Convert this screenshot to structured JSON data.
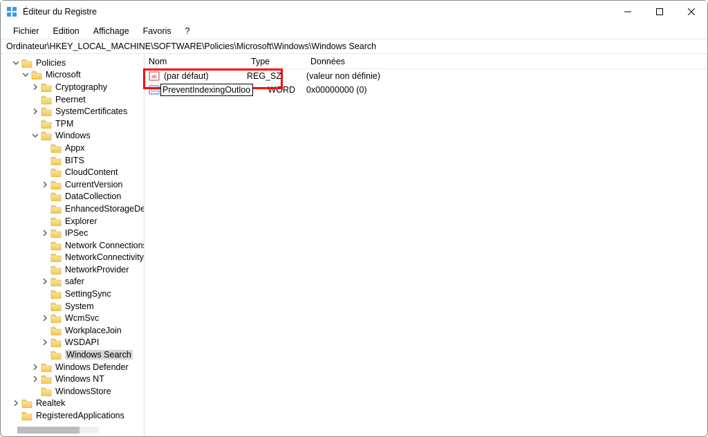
{
  "window": {
    "title": "Éditeur du Registre"
  },
  "menu": {
    "file": "Fichier",
    "edit": "Edition",
    "view": "Affichage",
    "favorites": "Favoris",
    "help": "?"
  },
  "address": {
    "path": "Ordinateur\\HKEY_LOCAL_MACHINE\\SOFTWARE\\Policies\\Microsoft\\Windows\\Windows Search"
  },
  "tree": {
    "policies": "Policies",
    "microsoft": "Microsoft",
    "items": {
      "cryptography": "Cryptography",
      "peernet": "Peernet",
      "systemcertificates": "SystemCertificates",
      "tpm": "TPM",
      "windows": "Windows"
    },
    "winitems": {
      "appx": "Appx",
      "bits": "BITS",
      "cloudcontent": "CloudContent",
      "currentversion": "CurrentVersion",
      "datacollection": "DataCollection",
      "enhancedstorage": "EnhancedStorageDevices",
      "explorer": "Explorer",
      "ipsec": "IPSec",
      "networkconnections": "Network Connections",
      "networkconnectivity": "NetworkConnectivityStatus",
      "networkprovider": "NetworkProvider",
      "safer": "safer",
      "settingsync": "SettingSync",
      "system": "System",
      "wcmsvc": "WcmSvc",
      "workplacejoin": "WorkplaceJoin",
      "wsdapi": "WSDAPI",
      "windowssearch": "Windows Search"
    },
    "after": {
      "windowsdefender": "Windows Defender",
      "windowsnt": "Windows NT",
      "windowsstore": "WindowsStore"
    },
    "realtek": "Realtek",
    "registeredapps": "RegisteredApplications"
  },
  "list": {
    "columns": {
      "name": "Nom",
      "type": "Type",
      "data": "Données"
    },
    "rows": [
      {
        "name": "(par défaut)",
        "type": "REG_SZ",
        "data": "(valeur non définie)"
      },
      {
        "name_editing": "PreventIndexingOutlook",
        "type_suffix": "WORD",
        "data": "0x00000000 (0)"
      }
    ]
  }
}
